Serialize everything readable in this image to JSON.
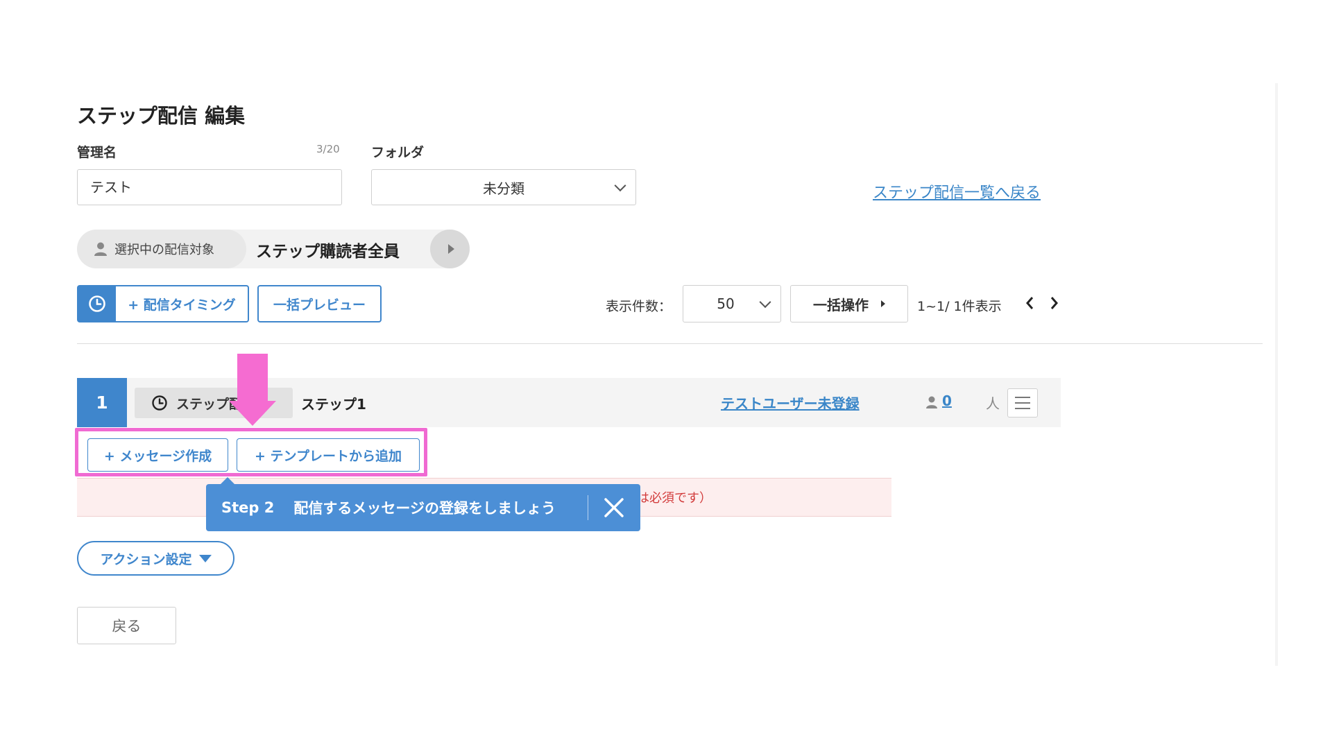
{
  "page_title": "ステップ配信 編集",
  "name_field": {
    "label": "管理名",
    "counter": "3/20",
    "value": "テスト"
  },
  "folder_field": {
    "label": "フォルダ",
    "selected": "未分類"
  },
  "back_to_list_link": "ステップ配信一覧へ戻る",
  "target": {
    "label": "選択中の配信対象",
    "value": "ステップ購読者全員"
  },
  "toolbar": {
    "add_timing_label": "+ 配信タイミング",
    "bulk_preview_label": "一括プレビュー",
    "per_page_label": "表示件数：",
    "per_page_value": "50",
    "bulk_ops_label": "一括操作",
    "pagination_text": "1~1/ 1件表示"
  },
  "step": {
    "number": "1",
    "chip_label": "ステップ配信",
    "name": "ステップ1",
    "test_user_link": "テストユーザー未登録",
    "count": "0",
    "count_unit": "人"
  },
  "message_actions": {
    "create_label": "+ メッセージ作成",
    "template_label": "+ テンプレートから追加"
  },
  "alert_text": "は必須です）",
  "tooltip": {
    "step": "Step 2",
    "text": "配信するメッセージの登録をしましょう"
  },
  "action_settings_label": "アクション設定",
  "back_button_label": "戻る",
  "colors": {
    "primary": "#3f86cc",
    "highlight": "#f06ad2",
    "tooltip": "#4c8fd6",
    "alert": "#d23c3c"
  }
}
